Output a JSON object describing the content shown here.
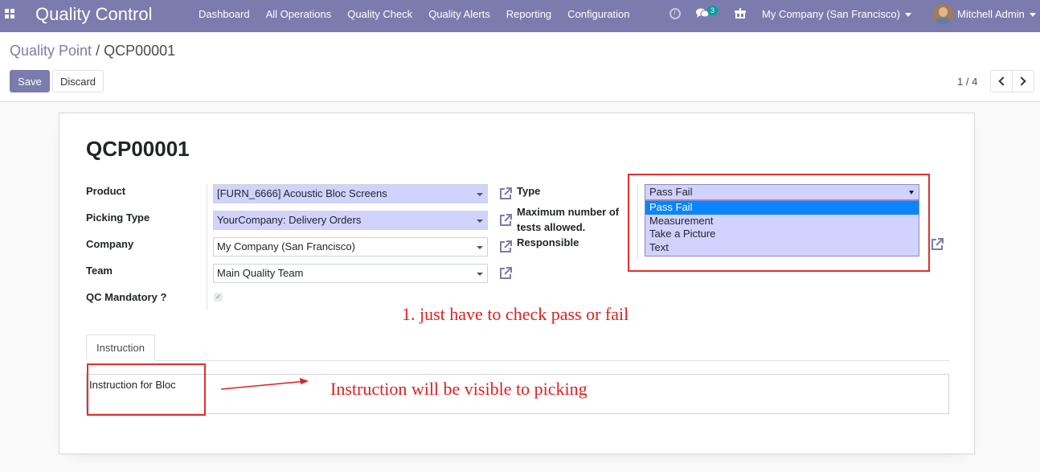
{
  "navbar": {
    "brand": "Quality Control",
    "menu": [
      "Dashboard",
      "All Operations",
      "Quality Check",
      "Quality Alerts",
      "Reporting",
      "Configuration"
    ],
    "chat_badge": "3",
    "company": "My Company (San Francisco)",
    "user": "Mitchell Admin"
  },
  "breadcrumb": {
    "parent": "Quality Point",
    "separator": "/",
    "current": "QCP00001"
  },
  "buttons": {
    "save": "Save",
    "discard": "Discard"
  },
  "pager": {
    "value": "1 / 4"
  },
  "form": {
    "title": "QCP00001",
    "fields": {
      "product": {
        "label": "Product",
        "value": "[FURN_6666] Acoustic Bloc Screens"
      },
      "picking_type": {
        "label": "Picking Type",
        "value": "YourCompany: Delivery Orders"
      },
      "company": {
        "label": "Company",
        "value": "My Company (San Francisco)"
      },
      "team": {
        "label": "Team",
        "value": "Main Quality Team"
      },
      "qc_mandatory": {
        "label": "QC Mandatory ?",
        "checked": true
      },
      "type": {
        "label": "Type",
        "value": "Pass Fail",
        "options": [
          "Pass Fail",
          "Measurement",
          "Take a Picture",
          "Text"
        ]
      },
      "max_tests": {
        "label_line1": "Maximum number of",
        "label_line2": "tests allowed."
      },
      "responsible": {
        "label": "Responsible"
      }
    },
    "tabs": [
      "Instruction"
    ],
    "instruction_text": "Instruction for Bloc"
  },
  "annotations": {
    "note1": "1. just have to check pass or fail",
    "note2": "Instruction will be visible to picking"
  },
  "colors": {
    "navbar": "#7c7bad",
    "primary": "#7c7bad",
    "annotation_red": "#e03030",
    "required_field": "#d2d2ff"
  },
  "icons": [
    "apps-grid-icon",
    "clock-icon",
    "chat-icon",
    "gift-icon",
    "external-link-icon",
    "chevron-left-icon",
    "chevron-right-icon"
  ]
}
